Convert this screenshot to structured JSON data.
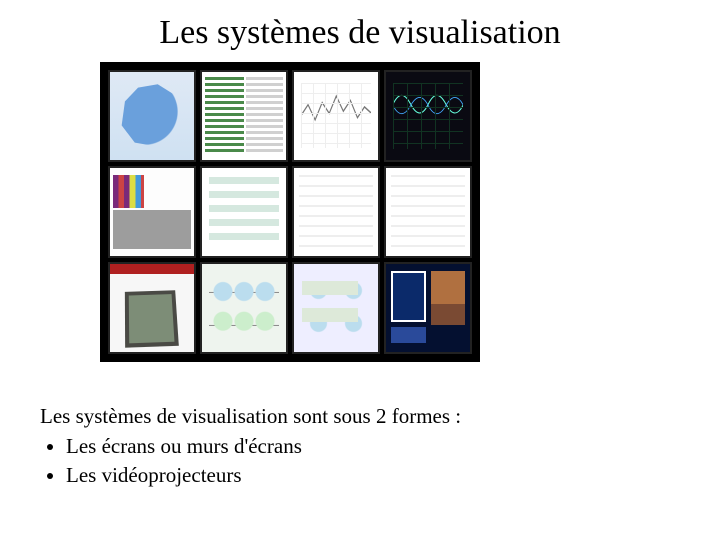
{
  "title": "Les systèmes de visualisation",
  "body": {
    "intro": "Les systèmes de visualisation sont sous 2 formes :",
    "bullets": [
      "Les écrans ou murs d'écrans",
      "Les vidéoprojecteurs"
    ]
  }
}
